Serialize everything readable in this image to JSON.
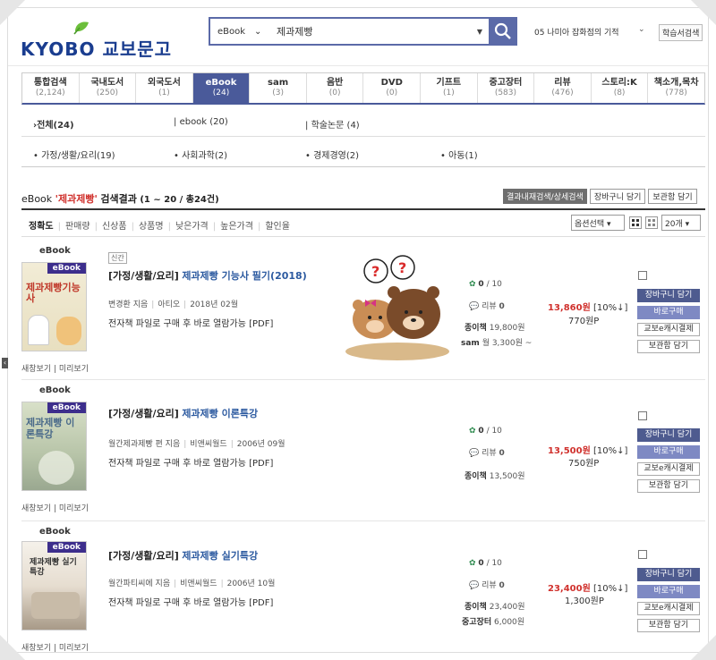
{
  "header": {
    "logo_text": "KYOBO 교보문고",
    "search_category": "eBook",
    "search_value": "제과제빵",
    "store_label": "05 나미아 잡화점의 기적",
    "store_button": "학습서검색"
  },
  "tabs": [
    {
      "label": "통합검색",
      "count": "(2,124)"
    },
    {
      "label": "국내도서",
      "count": "(250)"
    },
    {
      "label": "외국도서",
      "count": "(1)"
    },
    {
      "label": "eBook",
      "count": "(24)",
      "active": true
    },
    {
      "label": "sam",
      "count": "(3)"
    },
    {
      "label": "음반",
      "count": "(0)"
    },
    {
      "label": "DVD",
      "count": "(0)"
    },
    {
      "label": "기프트",
      "count": "(1)"
    },
    {
      "label": "중고장터",
      "count": "(583)"
    },
    {
      "label": "리뷰",
      "count": "(476)"
    },
    {
      "label": "스토리:K",
      "count": "(8)"
    },
    {
      "label": "책소개,목차",
      "count": "(778)"
    }
  ],
  "subcats1": [
    "전체(24)",
    "ebook (20)",
    "학술논문 (4)"
  ],
  "subcats2": [
    "가정/생활/요리(19)",
    "사회과학(2)",
    "경제경영(2)",
    "아동(1)"
  ],
  "results": {
    "prefix": "eBook",
    "keyword": "'제과제빵'",
    "suffix": "검색결과",
    "count": "(1 ~ 20 / 총24건)",
    "btn_research": "결과내재검색/상세검색",
    "btn_cart": "장바구니 담기",
    "btn_keep": "보관함 담기"
  },
  "sort": {
    "items": [
      "정확도",
      "판매량",
      "신상품",
      "상품명",
      "낮은가격",
      "높은가격",
      "할인율"
    ],
    "option_select": "옵션선택",
    "count_select": "20개"
  },
  "items": [
    {
      "ebook_label": "eBook",
      "badge": "신간",
      "category": "[가정/생활/요리]",
      "title": "제과제빵 기능사 필기(2018)",
      "author": "변경환 지음",
      "publisher": "아티오",
      "date": "2018년 02월",
      "desc": "전자책 파일로 구매 후 바로 열람가능 [PDF]",
      "cover_text": "제과제빵기능사",
      "preview": "새창보기 | 미리보기",
      "rating": "0",
      "rating_max": "/ 10",
      "review_label": "리뷰",
      "review": "0",
      "paper_label": "종이책",
      "paper_price": "19,800원",
      "extra_label": "sam",
      "extra_price": "월 3,300원 ~",
      "price": "13,860원",
      "discount": "[10%↓]",
      "points": "770원P",
      "btn_cart": "장바구니 담기",
      "btn_buy": "바로구매",
      "btn_cash": "교보e캐시결제",
      "btn_keep": "보관함 담기"
    },
    {
      "ebook_label": "eBook",
      "category": "[가정/생활/요리]",
      "title": "제과제빵 이론특강",
      "author": "월간제과제빵 편 지음",
      "publisher": "비앤씨월드",
      "date": "2006년 09월",
      "desc": "전자책 파일로 구매 후 바로 열람가능 [PDF]",
      "cover_text": "제과제빵 이론특강",
      "preview": "새창보기 | 미리보기",
      "rating": "0",
      "rating_max": "/ 10",
      "review_label": "리뷰",
      "review": "0",
      "paper_label": "종이책",
      "paper_price": "13,500원",
      "price": "13,500원",
      "discount": "[10%↓]",
      "points": "750원P",
      "btn_cart": "장바구니 담기",
      "btn_buy": "바로구매",
      "btn_cash": "교보e캐시결제",
      "btn_keep": "보관함 담기"
    },
    {
      "ebook_label": "eBook",
      "category": "[가정/생활/요리]",
      "title": "제과제빵 실기특강",
      "author": "월간파티씨에 지음",
      "publisher": "비앤씨월드",
      "date": "2006년 10월",
      "desc": "전자책 파일로 구매 후 바로 열람가능 [PDF]",
      "cover_text": "제과제빵 실기특강",
      "preview": "새창보기 | 미리보기",
      "rating": "0",
      "rating_max": "/ 10",
      "review_label": "리뷰",
      "review": "0",
      "paper_label": "종이책",
      "paper_price": "23,400원",
      "extra_label": "중고장터",
      "extra_price": "6,000원",
      "price": "23,400원",
      "discount": "[10%↓]",
      "points": "1,300원P",
      "btn_cart": "장바구니 담기",
      "btn_buy": "바로구매",
      "btn_cash": "교보e캐시결제",
      "btn_keep": "보관함 담기"
    }
  ],
  "colors": {
    "brand": "#1a3d8f",
    "accent": "#4a5a9a",
    "price": "#d0312d",
    "title": "#2c5aa0"
  }
}
